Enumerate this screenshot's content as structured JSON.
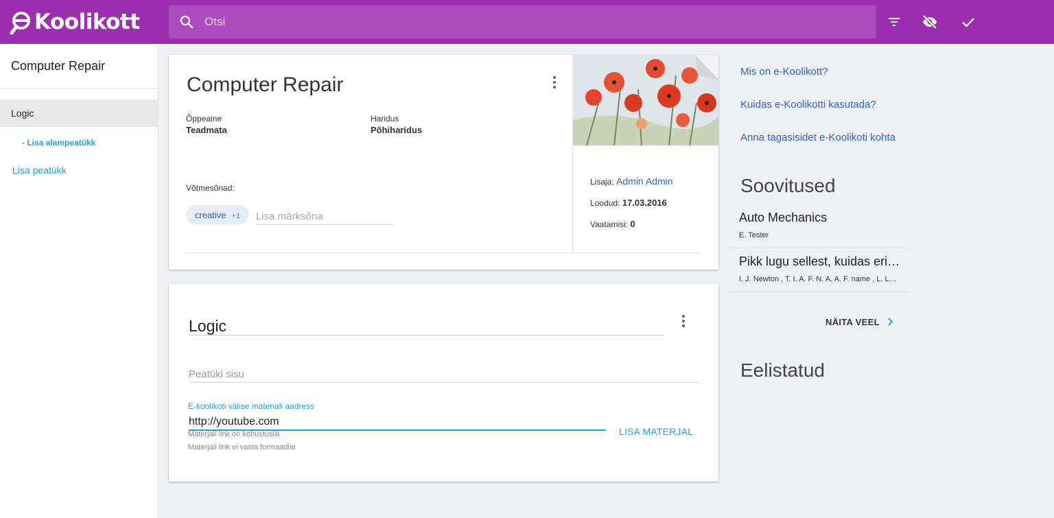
{
  "app": {
    "logo_text": "Koolikott",
    "search_placeholder": "Otsi",
    "icons": [
      "filter-icon",
      "visibility-off-icon",
      "check-icon"
    ]
  },
  "sidebar": {
    "title": "Computer Repair",
    "chapter": "Logic",
    "add_subchapter": "- Lisa alampeatükk",
    "add_chapter": "Lisa peatükk"
  },
  "material": {
    "title": "Computer Repair",
    "subject_label": "Õppeaine",
    "subject_value": "Teadmata",
    "education_label": "Haridus",
    "education_value": "Põhiharidus",
    "keywords_label": "Võtmesõnad:",
    "keyword_chip": "creative",
    "keyword_more": "+1",
    "keyword_placeholder": "Lisa märksõna",
    "added_by_label": "Lisaja:",
    "added_by_value": "Admin Admin",
    "created_label": "Loodud:",
    "created_value": "17.03.2016",
    "views_label": "Vaatamisi:",
    "views_value": "0"
  },
  "chapter": {
    "title": "Logic",
    "content_placeholder": "Peatüki sisu",
    "url_label": "E-koolikoti välise materiali aadress",
    "url_value": "http://youtube.com",
    "hint_required": "Materjali link on kohustuslik",
    "hint_format": "Materjali link ei vasta formaadile",
    "add_button": "LISA MATERJAL"
  },
  "right": {
    "links": [
      "Mis on e-Koolikott?",
      "Kuidas e-Koolikotti kasutada?",
      "Anna tagasisidet e-Koolikoti kohta"
    ],
    "recommendations_heading": "Soovitused",
    "recommendations": [
      {
        "title": "Auto Mechanics",
        "authors": "E. Tester"
      },
      {
        "title": "Pikk lugu sellest, kuidas erinevad asjad toimivad",
        "authors": "I. J. Newton , T. I. A. F. N. A. A. F. name , L. Lastname"
      }
    ],
    "show_more": "NÄITA VEEL",
    "favorites_heading": "Eelistatud"
  },
  "colors": {
    "brand": "#9b2fae",
    "accent": "#1fa0dc",
    "link": "#2d62c7"
  }
}
